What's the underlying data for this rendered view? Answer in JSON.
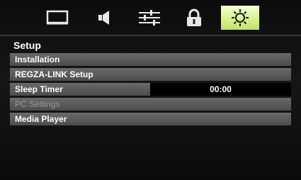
{
  "tabs": [
    {
      "name": "picture-icon",
      "active": false
    },
    {
      "name": "sound-icon",
      "active": false
    },
    {
      "name": "preferences-icon",
      "active": false
    },
    {
      "name": "lock-icon",
      "active": false
    },
    {
      "name": "setup-icon",
      "active": true
    }
  ],
  "colors": {
    "active_tab": "#d7f38d",
    "row": "#5a5a5a",
    "disabled_text": "#9a9a9a"
  },
  "panel": {
    "title": "Setup",
    "items": [
      {
        "label": "Installation",
        "value": "",
        "enabled": true
      },
      {
        "label": "REGZA-LINK Setup",
        "value": "",
        "enabled": true
      },
      {
        "label": "Sleep Timer",
        "value": "00:00",
        "enabled": true
      },
      {
        "label": "PC Settings",
        "value": "",
        "enabled": false
      },
      {
        "label": "Media Player",
        "value": "",
        "enabled": true
      }
    ]
  }
}
